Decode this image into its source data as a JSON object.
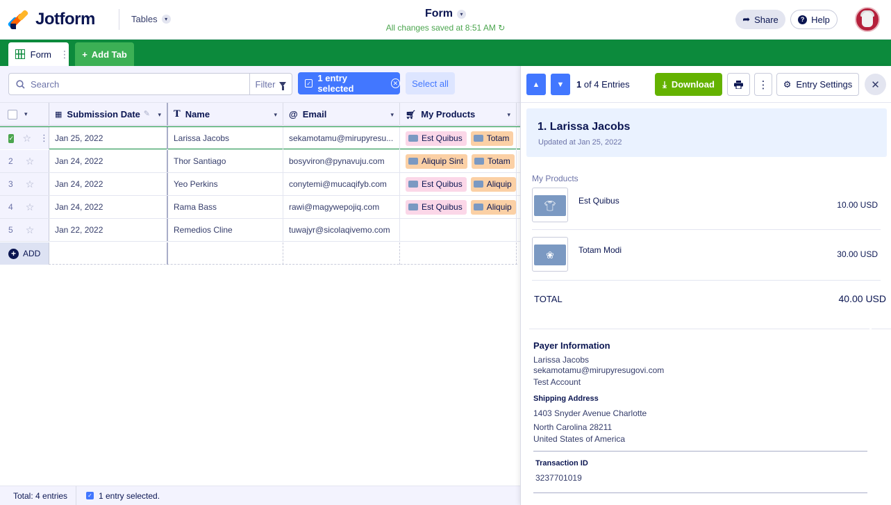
{
  "app": {
    "brand": "Jotform",
    "tables_label": "Tables",
    "form_title": "Form",
    "save_status": "All changes saved at 8:51 AM",
    "share_label": "Share",
    "help_label": "Help"
  },
  "tabs": {
    "form_label": "Form",
    "add_label": "Add Tab"
  },
  "toolbar": {
    "search_placeholder": "Search",
    "filter_label": "Filter",
    "selected_label": "1 entry selected",
    "select_all_label": "Select all"
  },
  "table": {
    "columns": [
      "Submission Date",
      "Name",
      "Email",
      "My Products"
    ],
    "rows": [
      {
        "num": "",
        "date": "Jan 25, 2022",
        "name": "Larissa Jacobs",
        "email": "sekamotamu@mirupyresu...",
        "products": [
          "Est Quibus",
          "Totam"
        ]
      },
      {
        "num": "2",
        "date": "Jan 24, 2022",
        "name": "Thor Santiago",
        "email": "bosyviron@pynavuju.com",
        "products": [
          "Aliquip Sint",
          "Totam"
        ]
      },
      {
        "num": "3",
        "date": "Jan 24, 2022",
        "name": "Yeo Perkins",
        "email": "conytemi@mucaqifyb.com",
        "products": [
          "Est Quibus",
          "Aliquip"
        ]
      },
      {
        "num": "4",
        "date": "Jan 24, 2022",
        "name": "Rama Bass",
        "email": "rawi@magywepojiq.com",
        "products": [
          "Est Quibus",
          "Aliquip"
        ]
      },
      {
        "num": "5",
        "date": "Jan 22, 2022",
        "name": "Remedios Cline",
        "email": "tuwajyr@sicolaqivemo.com",
        "products": []
      }
    ],
    "add_label": "ADD"
  },
  "footer": {
    "total": "Total: 4 entries",
    "selected": "1 entry selected."
  },
  "panel": {
    "entries_count": "1",
    "entries_text": " of 4 Entries",
    "download_label": "Download",
    "entry_settings_label": "Entry Settings",
    "entry_title": "1. Larissa Jacobs",
    "updated": "Updated at Jan 25, 2022",
    "products_label": "My Products",
    "products": [
      {
        "name": "Est Quibus",
        "price": "10.00 USD"
      },
      {
        "name": "Totam Modi",
        "price": "30.00 USD"
      }
    ],
    "total_label": "TOTAL",
    "total_value": "40.00 USD",
    "payer_title": "Payer Information",
    "payer_name": "Larissa Jacobs",
    "payer_email": "sekamotamu@mirupyresugovi.com",
    "payer_account": "Test Account",
    "shipping_title": "Shipping Address",
    "address_1": "1403 Snyder Avenue Charlotte",
    "address_2": "North Carolina 28211",
    "address_3": "United States of America",
    "transaction_title": "Transaction ID",
    "transaction_id": "3237701019"
  },
  "colors": {
    "brand_green": "#0c8a3c",
    "accent_blue": "#4277ff",
    "download_green": "#64b200",
    "navy": "#0a1551"
  }
}
